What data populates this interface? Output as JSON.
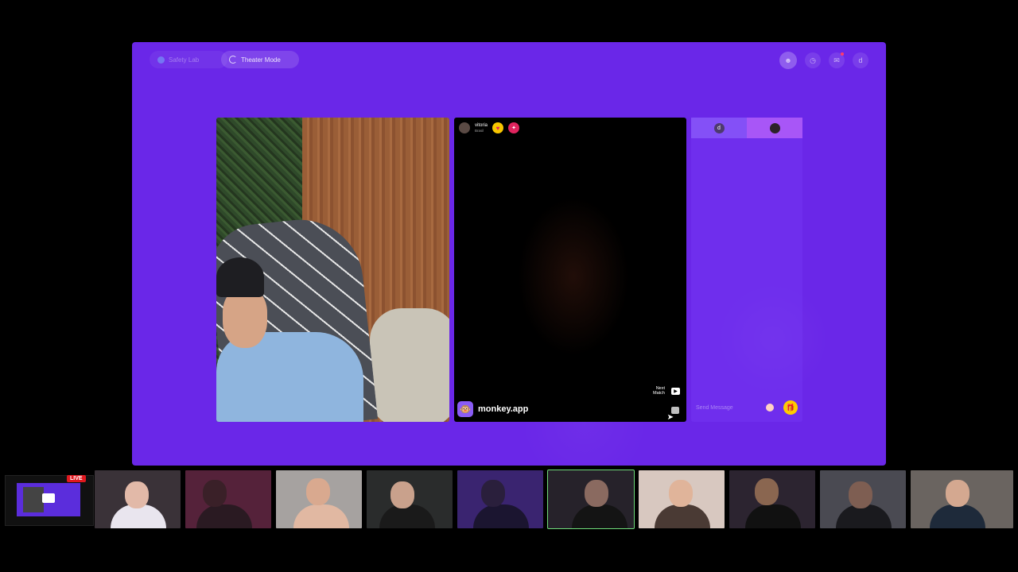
{
  "app": {
    "topbar": {
      "safety_lab": "Safety Lab",
      "theater_mode": "Theater Mode",
      "user_initial": "d"
    },
    "partner": {
      "name": "vitoria",
      "country": "Brasil",
      "brand": "monkey.app",
      "next_match": "Next\nMatch"
    },
    "chat": {
      "tab_self_initial": "d",
      "placeholder": "Send Message"
    }
  },
  "stream": {
    "live_badge": "LIVE"
  },
  "colors": {
    "app_bg": "#6a27e8",
    "gift_yellow": "#ffcc00",
    "live_red": "#e0181f",
    "active_outline": "#6fdc7a"
  }
}
